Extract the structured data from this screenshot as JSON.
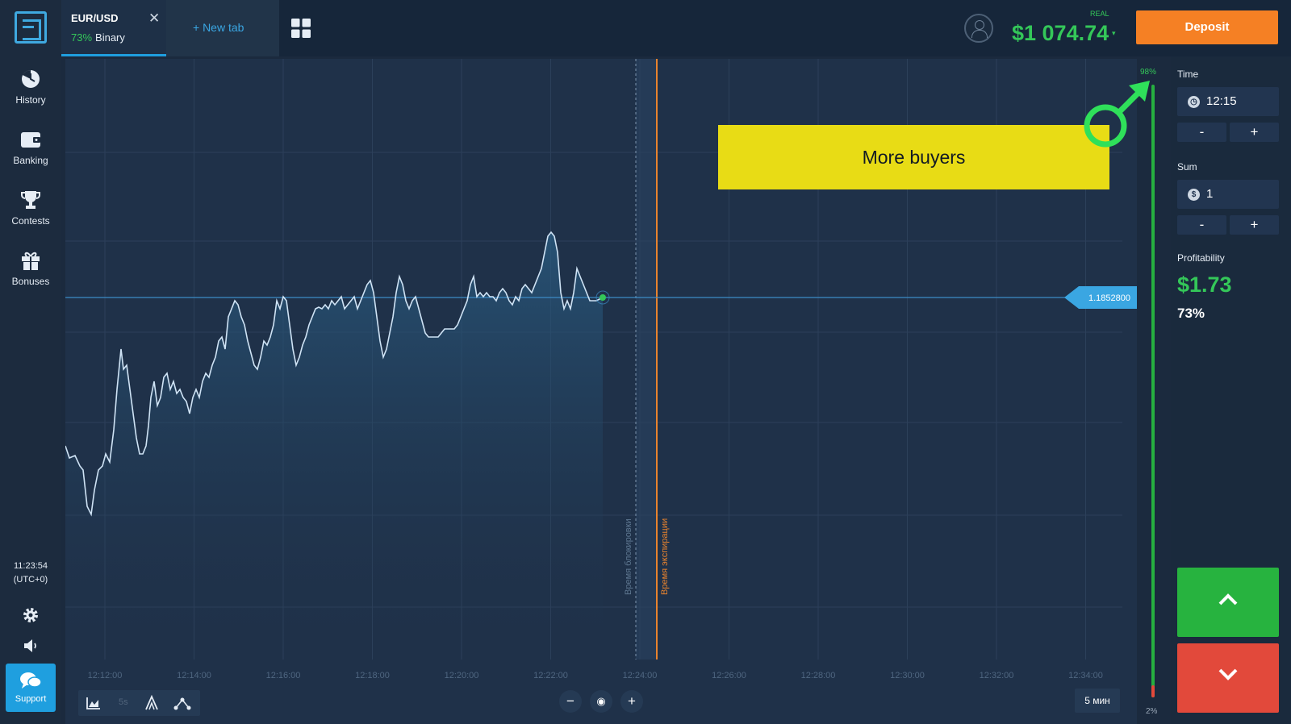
{
  "sidebar": {
    "items": [
      {
        "label": "History",
        "icon": "history-icon"
      },
      {
        "label": "Banking",
        "icon": "wallet-icon"
      },
      {
        "label": "Contests",
        "icon": "trophy-icon"
      },
      {
        "label": "Bonuses",
        "icon": "gift-icon"
      }
    ],
    "time": "11:23:54",
    "timezone": "(UTC+0)",
    "support_label": "Support"
  },
  "tabs": {
    "active": {
      "pair": "EUR/USD",
      "payout": "73%",
      "mode": "Binary"
    },
    "new_tab_label": "+  New tab"
  },
  "account": {
    "type": "REAL",
    "balance": "$1 074.74",
    "caret": "▾",
    "deposit_label": "Deposit"
  },
  "chart": {
    "current_price": "1.1852800",
    "lock_time_label": "Время блокировки",
    "expiry_time_label": "Время экспирации",
    "x_ticks": [
      "12:12:00",
      "12:14:00",
      "12:16:00",
      "12:18:00",
      "12:20:00",
      "12:22:00",
      "12:24:00",
      "12:26:00",
      "12:28:00",
      "12:30:00",
      "12:32:00",
      "12:34:00"
    ],
    "banner_text": "More buyers",
    "line_color": "#cfe3f5",
    "expiry_color": "#e8832e"
  },
  "sentiment": {
    "buyers_pct": "98%",
    "sellers_pct": "2%",
    "buyers_fraction": 0.98
  },
  "panel": {
    "time_label": "Time",
    "time_value": "12:15",
    "sum_label": "Sum",
    "sum_value": "1",
    "sum_currency_symbol": "$",
    "minus": "-",
    "plus": "+",
    "profit_label": "Profitability",
    "profit_value": "$1.73",
    "profit_pct": "73%"
  },
  "toolbar": {
    "interval_label": "5s",
    "zoom_out": "−",
    "zoom_reset": "◉",
    "zoom_in": "+",
    "timeframe": "5 мин"
  },
  "colors": {
    "accent": "#1f9fdf",
    "up": "#27b33f",
    "down": "#e2493b",
    "deposit": "#f58024",
    "banner": "#e8dc15"
  }
}
